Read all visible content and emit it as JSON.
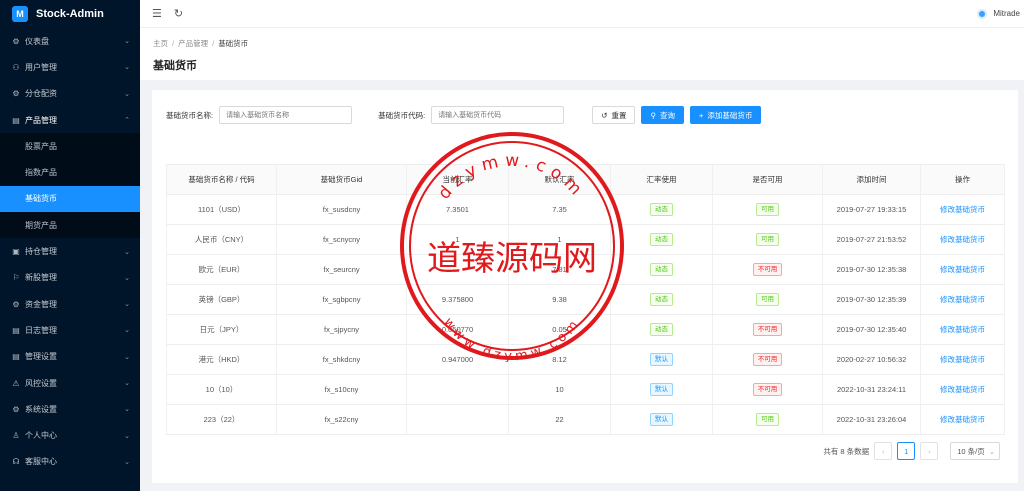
{
  "app": {
    "title": "Stock-Admin",
    "logo_glyph": "M"
  },
  "sidebar": {
    "items": [
      {
        "label": "仪表盘",
        "icon": "dashboard-icon",
        "glyph": "⚙"
      },
      {
        "label": "用户管理",
        "icon": "user-manage-icon",
        "glyph": "⚇"
      },
      {
        "label": "分仓配资",
        "icon": "allocation-icon",
        "glyph": "⚙"
      },
      {
        "label": "产品管理",
        "icon": "product-icon",
        "glyph": "▤"
      },
      {
        "label": "持仓管理",
        "icon": "position-icon",
        "glyph": "▣"
      },
      {
        "label": "新股管理",
        "icon": "ipo-icon",
        "glyph": "⚐"
      },
      {
        "label": "资金管理",
        "icon": "fund-icon",
        "glyph": "⚙"
      },
      {
        "label": "日志管理",
        "icon": "log-icon",
        "glyph": "▤"
      },
      {
        "label": "管理设置",
        "icon": "admin-settings-icon",
        "glyph": "▤"
      },
      {
        "label": "风控设置",
        "icon": "risk-icon",
        "glyph": "⚠"
      },
      {
        "label": "系统设置",
        "icon": "system-settings-icon",
        "glyph": "⚙"
      },
      {
        "label": "个人中心",
        "icon": "profile-icon",
        "glyph": "♙"
      },
      {
        "label": "客服中心",
        "icon": "support-icon",
        "glyph": "☊"
      }
    ],
    "sub_items": [
      {
        "label": "股票产品"
      },
      {
        "label": "指数产品"
      },
      {
        "label": "基础货币"
      },
      {
        "label": "期货产品"
      }
    ]
  },
  "header": {
    "username": "Mitrade"
  },
  "breadcrumb": {
    "items": [
      "主页",
      "产品管理",
      "基础货币"
    ]
  },
  "page_title": "基础货币",
  "search": {
    "name_label": "基础货币名称:",
    "name_placeholder": "请输入基础货币名称",
    "code_label": "基础货币代码:",
    "code_placeholder": "请输入基础货币代码",
    "reset_label": "重置",
    "query_label": "查询",
    "add_label": "添加基础货币"
  },
  "table": {
    "columns": [
      "基础货币名称 / 代码",
      "基础货币Gid",
      "当前汇率",
      "默认汇率",
      "汇率使用",
      "是否可用",
      "添加时间",
      "操作"
    ],
    "rows": [
      {
        "name": "1101（USD）",
        "gid": "fx_susdcny",
        "cur": "7.3501",
        "def": "7.35",
        "use": "动态",
        "use_type": "green",
        "avail": "可用",
        "avail_type": "green",
        "time": "2019-07-27 19:33:15",
        "op": "修改基础货币"
      },
      {
        "name": "人民币（CNY）",
        "gid": "fx_scnycny",
        "cur": "1",
        "def": "1",
        "use": "动态",
        "use_type": "green",
        "avail": "可用",
        "avail_type": "green",
        "time": "2019-07-27 21:53:52",
        "op": "修改基础货币"
      },
      {
        "name": "欧元（EUR）",
        "gid": "fx_seurcny",
        "cur": "",
        "def": "7.81",
        "use": "动态",
        "use_type": "green",
        "avail": "不可用",
        "avail_type": "red",
        "time": "2019-07-30 12:35:38",
        "op": "修改基础货币"
      },
      {
        "name": "英镑（GBP）",
        "gid": "fx_sgbpcny",
        "cur": "9.375800",
        "def": "9.38",
        "use": "动态",
        "use_type": "green",
        "avail": "可用",
        "avail_type": "green",
        "time": "2019-07-30 12:35:39",
        "op": "修改基础货币"
      },
      {
        "name": "日元（JPY）",
        "gid": "fx_sjpycny",
        "cur": "0.050770",
        "def": "0.05",
        "use": "动态",
        "use_type": "green",
        "avail": "不可用",
        "avail_type": "red",
        "time": "2019-07-30 12:35:40",
        "op": "修改基础货币"
      },
      {
        "name": "港元（HKD）",
        "gid": "fx_shkdcny",
        "cur": "0.947000",
        "def": "8.12",
        "use": "默认",
        "use_type": "blue",
        "avail": "不可用",
        "avail_type": "red",
        "time": "2020-02-27 10:56:32",
        "op": "修改基础货币"
      },
      {
        "name": "10（10）",
        "gid": "fx_s10cny",
        "cur": "",
        "def": "10",
        "use": "默认",
        "use_type": "blue",
        "avail": "不可用",
        "avail_type": "red",
        "time": "2022-10-31 23:24:11",
        "op": "修改基础货币"
      },
      {
        "name": "223（22）",
        "gid": "fx_s22cny",
        "cur": "",
        "def": "22",
        "use": "默认",
        "use_type": "blue",
        "avail": "可用",
        "avail_type": "green",
        "time": "2022-10-31 23:26:04",
        "op": "修改基础货币"
      }
    ]
  },
  "pager": {
    "total_text": "共有 8 条数据",
    "current_page": "1",
    "page_size": "10 条/页"
  },
  "watermark": {
    "text": "道臻源码网",
    "ring_top": "dzymw.com",
    "ring_bottom": "www.dzymw.com"
  },
  "colors": {
    "primary": "#1890ff",
    "sidebar_bg": "#001529",
    "seal_red": "#e0191d"
  }
}
